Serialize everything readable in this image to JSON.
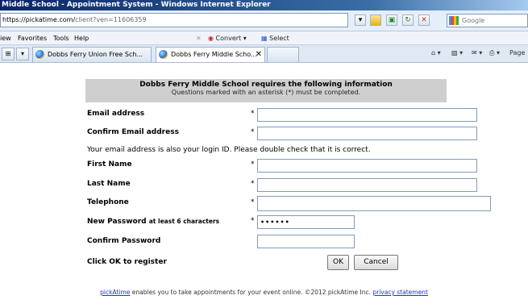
{
  "window": {
    "title": "Middle School - Appointment System - Windows Internet Explorer"
  },
  "address_bar": {
    "url_host": "https://pickatime.com/",
    "url_rest": "client?ven=11606359",
    "search_placeholder": "Google"
  },
  "menu": {
    "items": [
      "iew",
      "Favorites",
      "Tools",
      "Help"
    ],
    "convert_label": "Convert",
    "select_label": "Select"
  },
  "tabs": [
    {
      "label": "Dobbs Ferry Union Free Sch..."
    },
    {
      "label": "Dobbs Ferry Middle Scho..."
    }
  ],
  "command_bar": {
    "page_label": "Page"
  },
  "form": {
    "header_title": "Dobbs Ferry Middle School requires the following information",
    "header_subtitle": "Questions marked with an asterisk (*) must be completed.",
    "required_marker": "*",
    "fields": {
      "email": {
        "label": "Email address",
        "value": ""
      },
      "confirm_email": {
        "label": "Confirm Email address",
        "value": ""
      },
      "email_note": "Your email address is also your login ID. Please double check that it is correct.",
      "first_name": {
        "label": "First Name",
        "value": ""
      },
      "last_name": {
        "label": "Last Name",
        "value": ""
      },
      "telephone": {
        "label": "Telephone",
        "value": ""
      },
      "new_password": {
        "label": "New Password",
        "hint": "at least 6 characters",
        "value": "••••••"
      },
      "confirm_password": {
        "label": "Confirm Password",
        "value": ""
      }
    },
    "submit_prompt": "Click OK to register",
    "ok_label": "OK",
    "cancel_label": "Cancel"
  },
  "footer": {
    "brand_link": "pickAtime",
    "text": " enables you to take appointments for your event online. ©2012 pickAtime Inc. ",
    "privacy_link": "privacy statement"
  }
}
